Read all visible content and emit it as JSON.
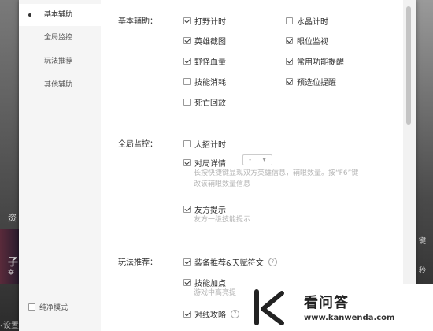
{
  "background": {
    "left_char_1": "资",
    "left_char_2": "子",
    "left_char_3": "宰",
    "right_char_1": "键",
    "right_char_2": "秒",
    "status_text": "设置"
  },
  "sidebar": {
    "items": [
      {
        "label": "基本辅助",
        "active": true
      },
      {
        "label": "全局监控",
        "active": false
      },
      {
        "label": "玩法推荐",
        "active": false
      },
      {
        "label": "其他辅助",
        "active": false
      }
    ],
    "pure_mode_label": "纯净模式"
  },
  "sections": {
    "basic": {
      "label": "基本辅助：",
      "options": [
        {
          "label": "打野计时",
          "checked": true
        },
        {
          "label": "水晶计时",
          "checked": false
        },
        {
          "label": "英雄截图",
          "checked": true
        },
        {
          "label": "眼位监视",
          "checked": true
        },
        {
          "label": "野怪血量",
          "checked": true
        },
        {
          "label": "常用功能提醒",
          "checked": true
        },
        {
          "label": "技能消耗",
          "checked": false
        },
        {
          "label": "预选位提醒",
          "checked": true
        },
        {
          "label": "死亡回放",
          "checked": false
        }
      ]
    },
    "global": {
      "label": "全局监控：",
      "ult_timer": {
        "label": "大招计时",
        "checked": false
      },
      "match_detail": {
        "label": "对局详情",
        "checked": true,
        "select_value": "-"
      },
      "match_detail_hint_1": "长按快捷键显现双方英雄信息，辅眼数量。按“F6”键",
      "match_detail_hint_2": "改该辅眼数量信息",
      "ally_tips": {
        "label": "友方提示",
        "checked": true
      },
      "ally_tips_hint": "友方一级技能提示"
    },
    "play": {
      "label": "玩法推荐：",
      "gear": {
        "label": "装备推荐&天赋符文",
        "checked": true
      },
      "skill": {
        "label": "技能加点",
        "checked": true
      },
      "skill_hint": "游戏中高亮提",
      "laning": {
        "label": "对线攻略",
        "checked": true
      }
    }
  },
  "watermark": {
    "title": "看问答",
    "url": "www.kanwenda.com"
  },
  "colors": {
    "dialog_bg": "#ffffff",
    "sidebar_bg": "#f5f5f5",
    "hint": "#b5b5b5"
  }
}
